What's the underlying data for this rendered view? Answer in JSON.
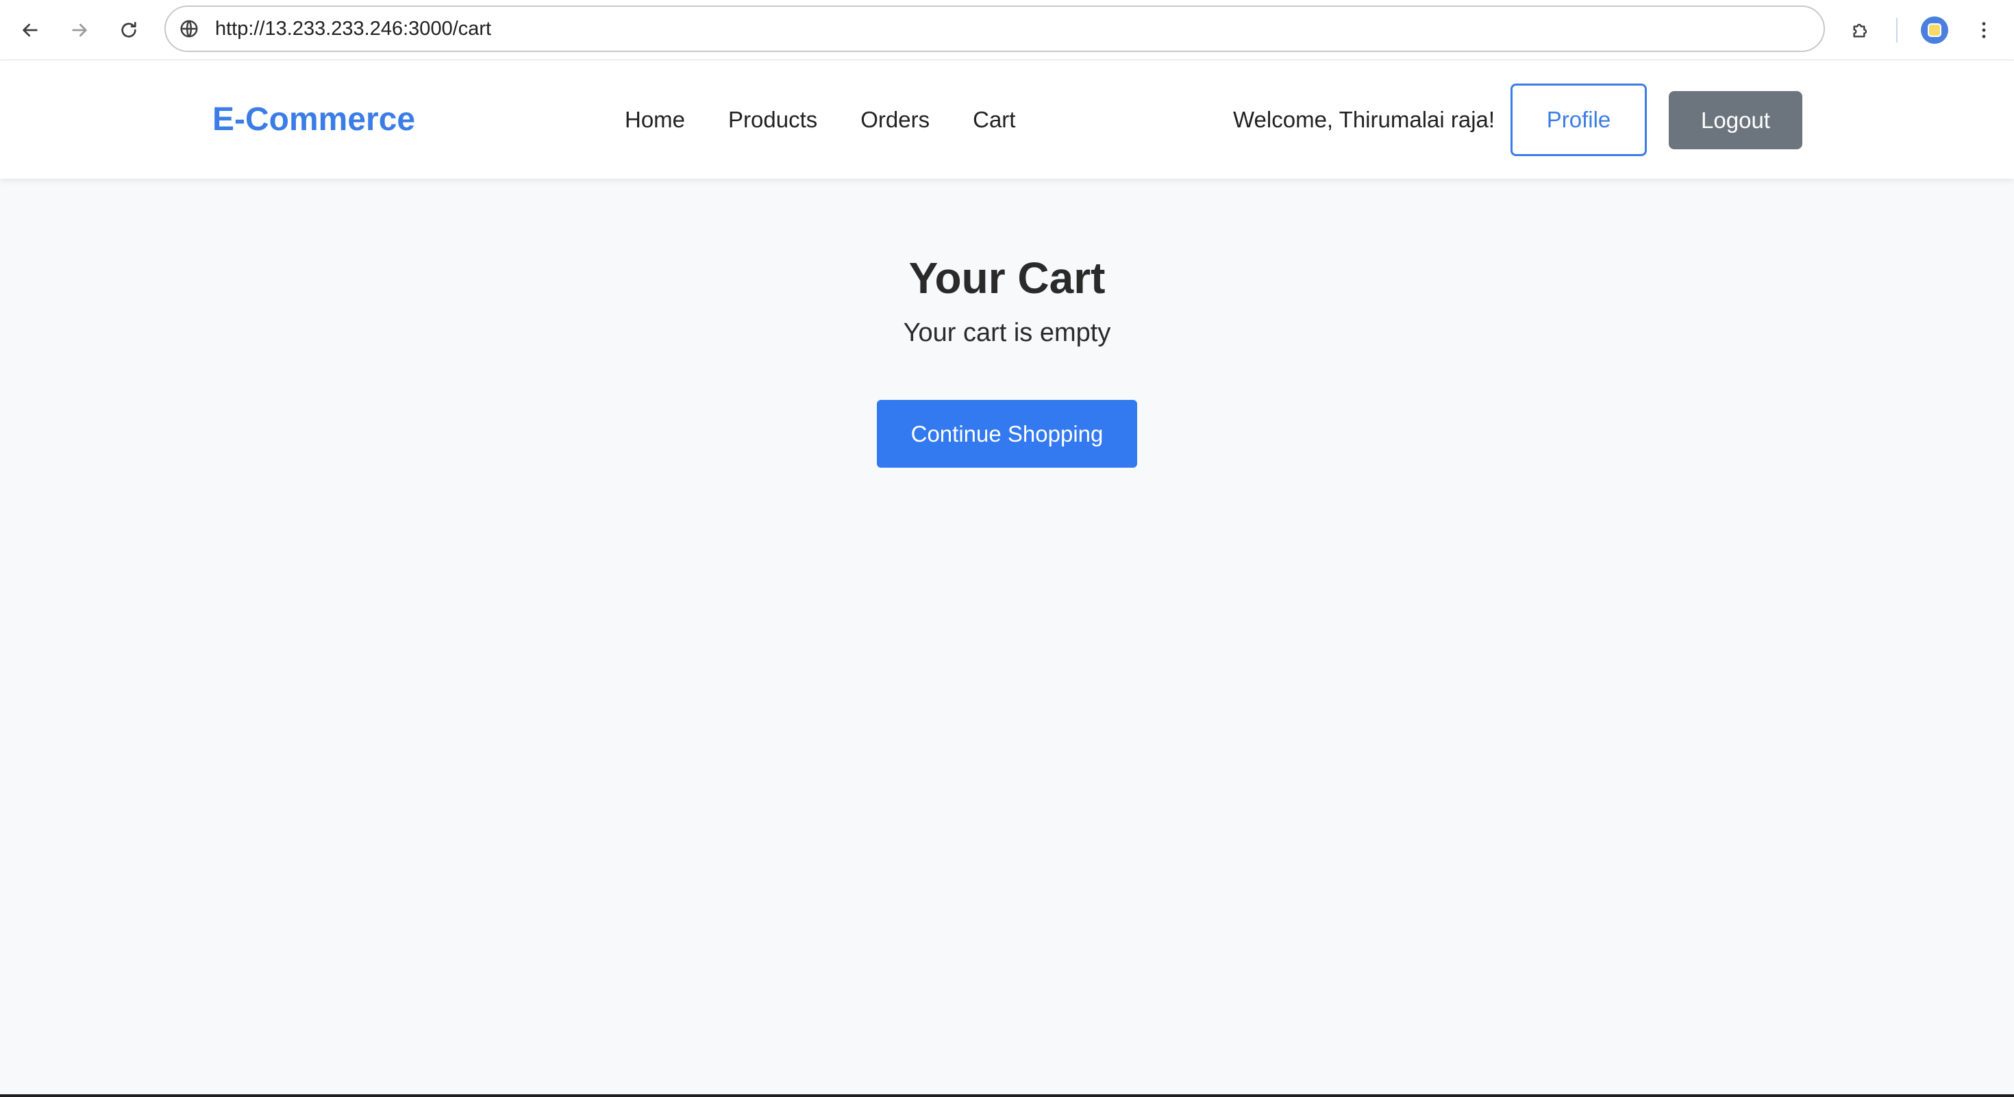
{
  "browser": {
    "url": "http://13.233.233.246:3000/cart",
    "icons": {
      "back": "arrow-left-icon",
      "forward": "arrow-right-icon",
      "reload": "reload-icon",
      "site_info": "globe-icon",
      "extensions": "puzzle-icon",
      "profile": "avatar-icon",
      "menu": "kebab-menu-icon"
    }
  },
  "header": {
    "brand": "E-Commerce",
    "nav": [
      "Home",
      "Products",
      "Orders",
      "Cart"
    ],
    "welcome": "Welcome, Thirumalai raja!",
    "profile_label": "Profile",
    "logout_label": "Logout"
  },
  "main": {
    "title": "Your Cart",
    "empty_message": "Your cart is empty",
    "continue_label": "Continue Shopping"
  },
  "colors": {
    "brand": "#3b7de6",
    "primary_button": "#3379ef",
    "secondary_button": "#6c757d",
    "page_background": "#f8f9fa"
  }
}
